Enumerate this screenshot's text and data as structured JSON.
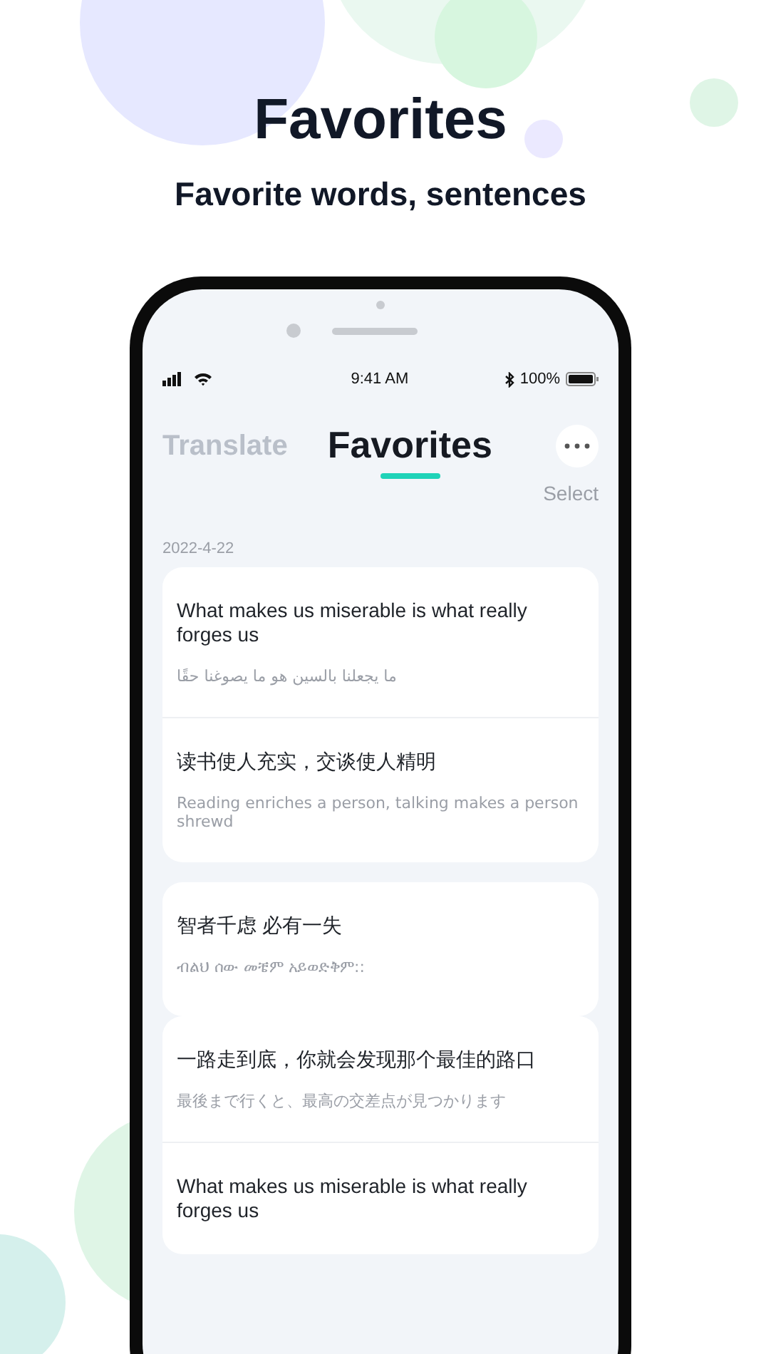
{
  "heading": "Favorites",
  "subheading": "Favorite words, sentences",
  "status_bar": {
    "time": "9:41 AM",
    "battery": "100%"
  },
  "tabs": [
    {
      "label": "Translate",
      "selected": false
    },
    {
      "label": "Favorites",
      "selected": true
    }
  ],
  "select_action": "Select",
  "date": "2022-4-22",
  "cards": [
    {
      "entries": [
        {
          "text": "What makes us miserable is what really forges us",
          "translation": "ما يجعلنا بالسين هو ما يصوغنا حقًا"
        },
        {
          "text": "读书使人充实，交谈使人精明",
          "translation": "Reading enriches a person, talking makes a person shrewd"
        }
      ]
    },
    {
      "entries": [
        {
          "text": "智者千虑 必有一失",
          "translation": "ብልህ ሰው መቼም አይወድቅም::"
        }
      ]
    },
    {
      "entries": [
        {
          "text": "一路走到底，你就会发现那个最佳的路口",
          "translation": "最後まで行くと、最高の交差点が見つかります"
        },
        {
          "text": "What makes us miserable is what really forges us"
        }
      ]
    }
  ]
}
